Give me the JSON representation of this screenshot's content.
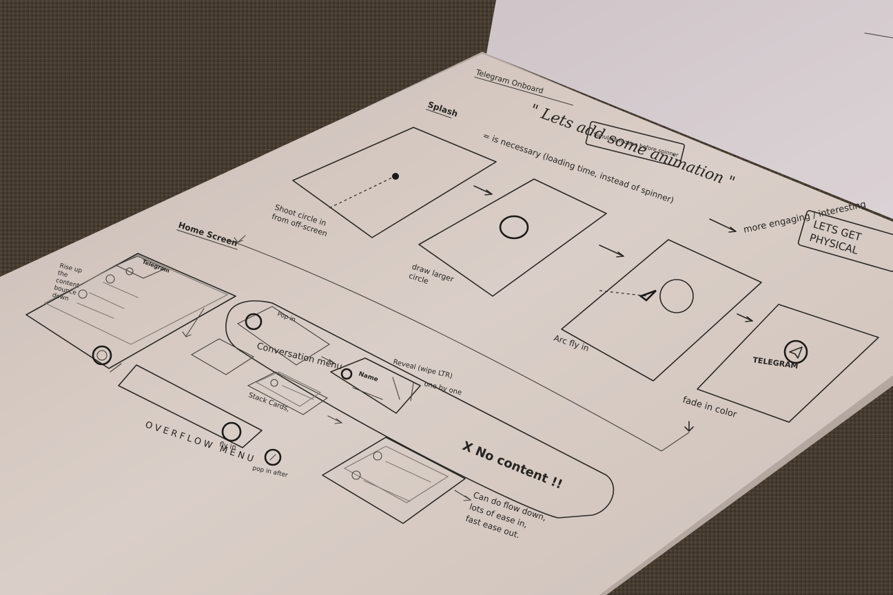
{
  "notebook": {
    "header_left": "Telegram Onboard",
    "quote": "\" Lets add some animation \"",
    "boxed_note_top": "Simulate motion before spinner",
    "subhead_left": "Splash",
    "splash_note": "= is necessary (loading time, instead of spinner)",
    "arrow_note": "more engaging / interesting",
    "boxed_note_right_line1": "LETS GET",
    "boxed_note_right_line2": "PHYSICAL"
  },
  "frames": {
    "f1_caption_line1": "Shoot circle in",
    "f1_caption_line2": "from off-screen",
    "f2_caption_line1": "draw larger",
    "f2_caption_line2": "circle",
    "f3_caption": "Arc fly in",
    "f4_logo": "TELEGRAM",
    "f4_caption": "fade in color"
  },
  "home_section": {
    "title": "Home Screen",
    "side_note_line1": "Rise up",
    "side_note_line2": "the",
    "side_note_line3": "content",
    "side_note_line4": "bounce",
    "side_note_line5": "down",
    "app_label": "Telegram",
    "pop_in": "Pop in",
    "conversation_menu": "Conversation menu",
    "name_label": "Name",
    "reveal_note": "Reveal (wipe LTR)",
    "one_by_one": "one by one",
    "stack_cards": "Stack Cards,",
    "overflow_menu": "OVERFLOW MENU",
    "fly_in": "fly in",
    "pop_in_after": "pop in after",
    "no_content": "X  No content !!",
    "flow_note_line1": "Can do flow down,",
    "flow_note_line2": "lots of ease in,",
    "flow_note_line3": "fast ease out."
  },
  "colors": {
    "floor": "#4a3f33",
    "page": "#e6d9d2",
    "page_shadow": "#cdbfb8",
    "ink": "#2e2a27"
  }
}
